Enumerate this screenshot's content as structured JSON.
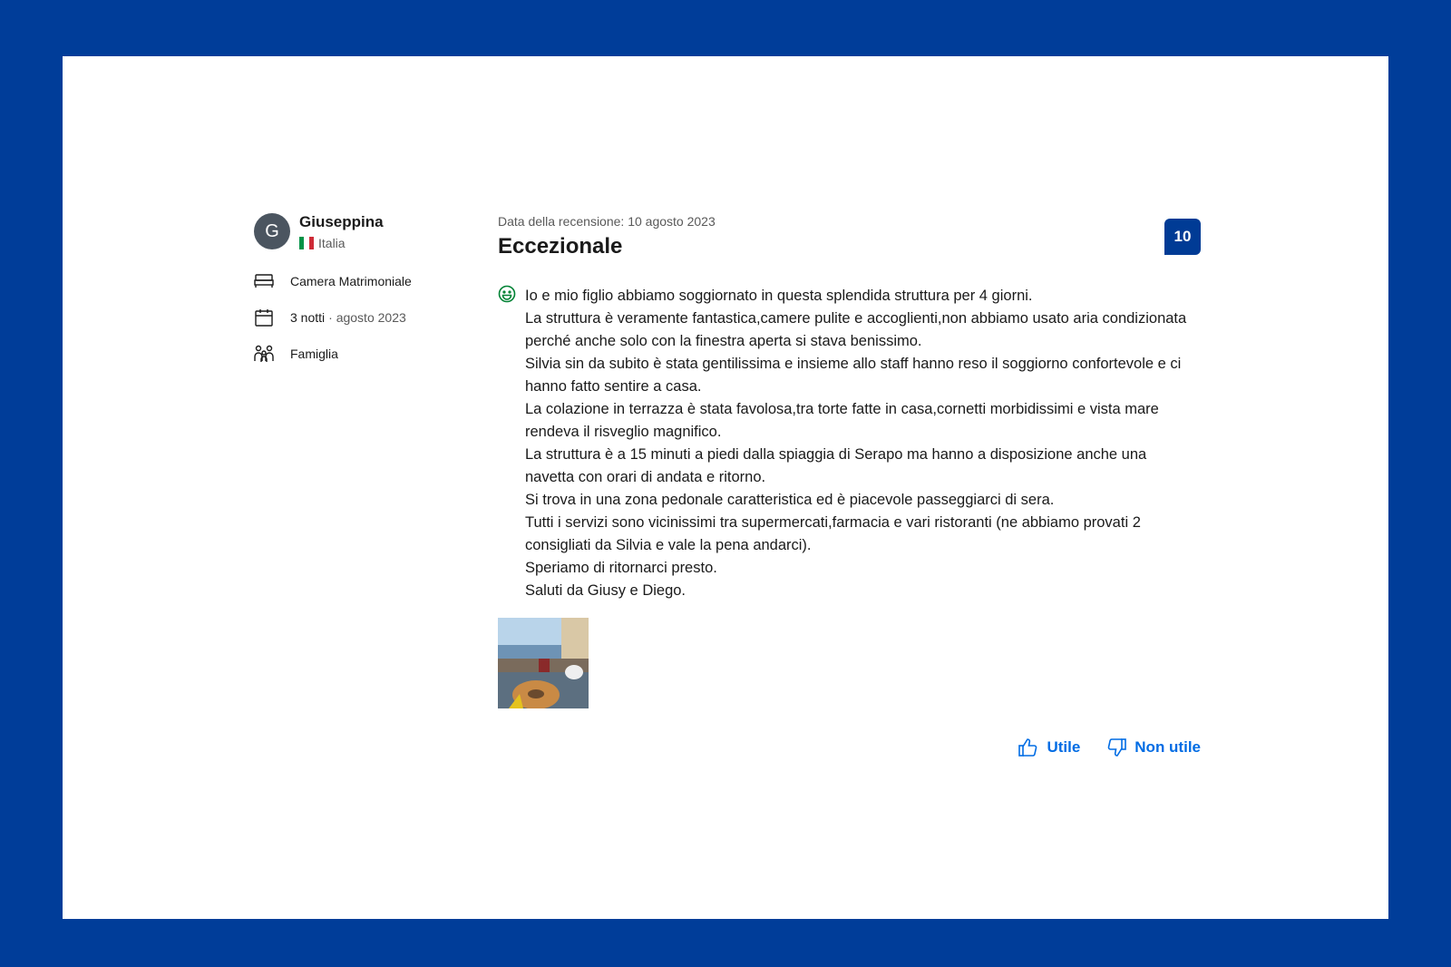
{
  "reviewer": {
    "initial": "G",
    "name": "Giuseppina",
    "country": "Italia",
    "room": "Camera Matrimoniale",
    "nights": "3 notti",
    "stay_date": "· agosto 2023",
    "traveler_type": "Famiglia"
  },
  "review": {
    "date_line": "Data della recensione: 10 agosto 2023",
    "title": "Eccezionale",
    "score": "10",
    "lines": [
      "Io e mio figlio abbiamo soggiornato in questa splendida struttura per 4 giorni.",
      "La struttura è veramente fantastica,camere pulite e accoglienti,non abbiamo usato aria condizionata perché anche solo con la finestra aperta si stava benissimo.",
      "Silvia sin da subito è stata gentilissima e insieme allo staff hanno reso il soggiorno confortevole e ci hanno fatto sentire a casa.",
      "La colazione in terrazza è stata favolosa,tra torte fatte in casa,cornetti morbidissimi e vista mare rendeva il risveglio magnifico.",
      "La struttura è a 15 minuti a piedi dalla spiaggia di Serapo ma hanno a disposizione anche una navetta con orari di andata e ritorno.",
      "Si trova in una zona pedonale caratteristica ed è piacevole passeggiarci di sera.",
      "Tutti i servizi sono vicinissimi tra supermercati,farmacia e vari ristoranti (ne abbiamo provati 2 consigliati da Silvia e vale la pena andarci).",
      "Speriamo di ritornarci presto.",
      "Saluti da Giusy e Diego."
    ]
  },
  "actions": {
    "helpful": "Utile",
    "not_helpful": "Non utile"
  },
  "colors": {
    "frame": "#003d99",
    "score_bg": "#003b95",
    "link": "#006ce4",
    "positive": "#008234"
  }
}
